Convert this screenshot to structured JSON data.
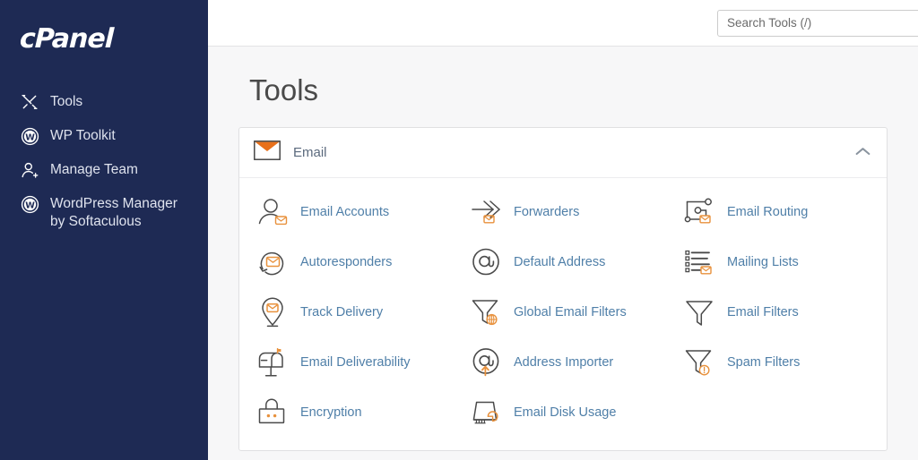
{
  "sidebar": {
    "logo_text": "cPanel",
    "items": [
      {
        "label": "Tools",
        "icon": "tools-icon"
      },
      {
        "label": "WP Toolkit",
        "icon": "wordpress-icon"
      },
      {
        "label": "Manage Team",
        "icon": "manage-team-icon"
      },
      {
        "label": "WordPress Manager by Softaculous",
        "icon": "wordpress-icon"
      }
    ]
  },
  "header": {
    "search_placeholder": "Search Tools (/)",
    "search_value": ""
  },
  "main": {
    "page_title": "Tools"
  },
  "panel": {
    "title": "Email",
    "icon": "envelope-icon",
    "collapse_icon": "chevron-up-icon",
    "expanded": true,
    "tools": [
      {
        "label": "Email Accounts",
        "icon": "email-accounts-icon"
      },
      {
        "label": "Forwarders",
        "icon": "forwarders-icon"
      },
      {
        "label": "Email Routing",
        "icon": "email-routing-icon"
      },
      {
        "label": "Autoresponders",
        "icon": "autoresponders-icon"
      },
      {
        "label": "Default Address",
        "icon": "default-address-icon"
      },
      {
        "label": "Mailing Lists",
        "icon": "mailing-lists-icon"
      },
      {
        "label": "Track Delivery",
        "icon": "track-delivery-icon"
      },
      {
        "label": "Global Email Filters",
        "icon": "global-email-filters-icon"
      },
      {
        "label": "Email Filters",
        "icon": "email-filters-icon"
      },
      {
        "label": "Email Deliverability",
        "icon": "email-deliverability-icon"
      },
      {
        "label": "Address Importer",
        "icon": "address-importer-icon"
      },
      {
        "label": "Spam Filters",
        "icon": "spam-filters-icon"
      },
      {
        "label": "Encryption",
        "icon": "encryption-icon"
      },
      {
        "label": "Email Disk Usage",
        "icon": "email-disk-usage-icon"
      }
    ]
  },
  "colors": {
    "sidebar_bg": "#1e2a54",
    "accent_orange": "#e8701a",
    "badge_orange": "#f0a050",
    "link_blue": "#4f7fa8",
    "icon_gray": "#5a5a5a",
    "page_bg": "#f7f7f8"
  }
}
